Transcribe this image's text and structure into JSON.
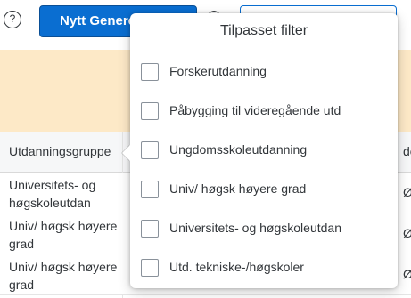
{
  "toolbar": {
    "help_glyph": "?",
    "primary_button_label": "Nytt Genere"
  },
  "table": {
    "header_first": "Utdanningsgruppe",
    "header_right": "del",
    "rows": [
      {
        "label": "Universitets- og høgskoleutdan",
        "right": "ØID"
      },
      {
        "label": "Univ/ høgsk høyere grad",
        "right": "ØID"
      },
      {
        "label": "Univ/ høgsk høyere grad",
        "right": "ØID"
      }
    ]
  },
  "filter_popover": {
    "title": "Tilpasset filter",
    "options": [
      {
        "label": "Forskerutdanning",
        "checked": false
      },
      {
        "label": "Påbygging til videregående utd",
        "checked": false
      },
      {
        "label": "Ungdomsskoleutdanning",
        "checked": false
      },
      {
        "label": "Univ/ høgsk høyere grad",
        "checked": false
      },
      {
        "label": "Universitets- og høgskoleutdan",
        "checked": false
      },
      {
        "label": "Utd. tekniske-/høgskoler",
        "checked": false
      }
    ]
  },
  "colors": {
    "primary": "#0a6ed1",
    "highlight_band": "#fde9c7"
  }
}
